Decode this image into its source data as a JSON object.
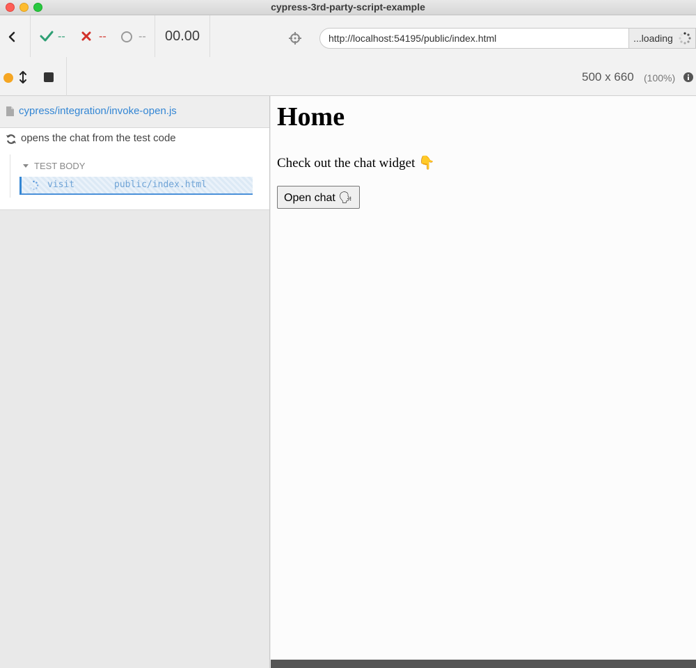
{
  "window": {
    "title": "cypress-3rd-party-script-example"
  },
  "header": {
    "passed": "--",
    "failed": "--",
    "pending": "--",
    "duration": "00.00",
    "url": "http://localhost:54195/public/index.html",
    "loading_text": "...loading"
  },
  "toolbar": {
    "viewport_size": "500 x 660",
    "viewport_scale": "(100%)"
  },
  "reporter": {
    "spec_path": "cypress/integration/invoke-open.js",
    "test_title": "opens the chat from the test code",
    "hook_label": "TEST BODY",
    "command": {
      "name": "visit",
      "message": "public/index.html"
    }
  },
  "page": {
    "heading": "Home",
    "paragraph": "Check out the chat widget 👇",
    "button_label": "Open chat 🗣"
  },
  "colors": {
    "passed": "#2e9f74",
    "failed": "#d2312a",
    "link": "#3386d4",
    "running": "#f5a623"
  }
}
